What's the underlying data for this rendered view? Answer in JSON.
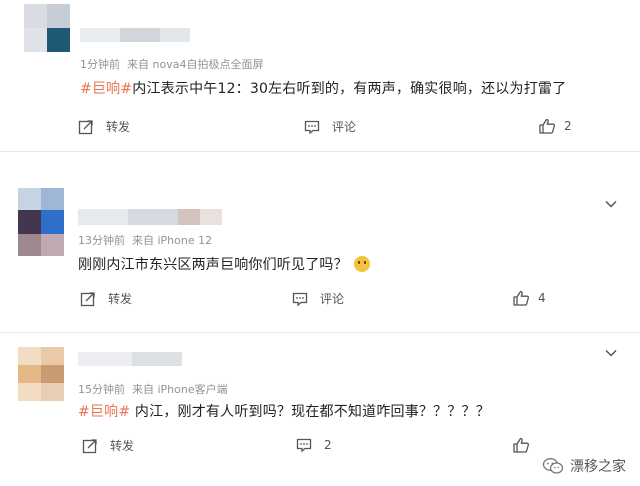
{
  "comments": [
    {
      "time": "1分钟前",
      "source": "来自 nova4自拍极点全面屏",
      "tag": "#巨响#",
      "text": "内江表示中午12：30左右听到的，有两声，确实很响，还以为打雷了",
      "repost_label": "转发",
      "comment_label": "评论",
      "like_count": "2"
    },
    {
      "time": "13分钟前",
      "source": "来自 iPhone 12",
      "tag": "",
      "text": "刚刚内江市东兴区两声巨响你们听见了吗？",
      "emoji": "emoji-icon",
      "repost_label": "转发",
      "comment_label": "评论",
      "like_count": "4"
    },
    {
      "time": "15分钟前",
      "source": "来自 iPhone客户端",
      "tag": "#巨响#",
      "text": " 内江，刚才有人听到吗？现在都不知道咋回事？？？？？",
      "repost_label": "转发",
      "comment_label": "评论",
      "comment_count": "2",
      "like_count": ""
    }
  ],
  "watermark": "漂移之家",
  "colors": {
    "tag": "#eb7350",
    "meta": "#939393",
    "divider": "#e6e6e6"
  }
}
